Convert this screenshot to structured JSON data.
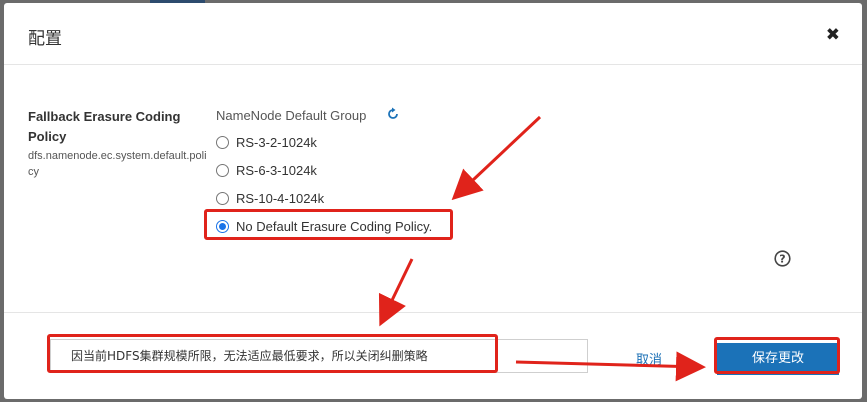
{
  "dialog": {
    "title": "配置",
    "close_label": "✖"
  },
  "property": {
    "display_name": "Fallback Erasure Coding Policy",
    "key": "dfs.namenode.ec.system.default.policy",
    "group_label": "NameNode Default Group",
    "options": [
      {
        "label": "RS-3-2-1024k",
        "selected": false
      },
      {
        "label": "RS-6-3-1024k",
        "selected": false
      },
      {
        "label": "RS-10-4-1024k",
        "selected": false
      },
      {
        "label": "No Default Erasure Coding Policy.",
        "selected": true
      }
    ]
  },
  "footer": {
    "change_note": "因当前HDFS集群规模所限，无法适应最低要求，所以关闭纠删策略",
    "cancel_label": "取消",
    "save_label": "保存更改"
  },
  "colors": {
    "accent": "#1b72b8",
    "annotation": "#e0231b"
  },
  "icons": [
    "refresh-icon",
    "help-icon",
    "close-icon"
  ]
}
